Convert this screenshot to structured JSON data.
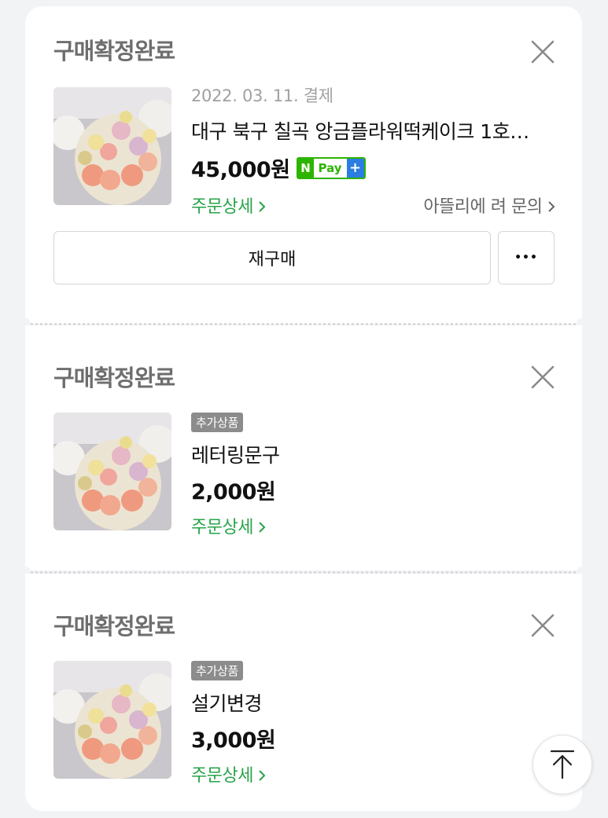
{
  "orders": [
    {
      "status": "구매확정완료",
      "date": "2022. 03. 11. 결제",
      "product": "대구 북구 칠곡 앙금플라워떡케이크 1호…",
      "price": "45,000원",
      "npay": {
        "n": "N",
        "pay": "Pay",
        "plus": "+"
      },
      "detail_link": "주문상세",
      "inquiry_link": "아뜰리에 려 문의",
      "rebuy_label": "재구매",
      "more_label": "•••"
    },
    {
      "status": "구매확정완료",
      "badge": "추가상품",
      "product": "레터링문구",
      "price": "2,000원",
      "detail_link": "주문상세"
    },
    {
      "status": "구매확정완료",
      "badge": "추가상품",
      "product": "설기변경",
      "price": "3,000원",
      "detail_link": "주문상세"
    }
  ],
  "colors": {
    "accent_green": "#27a348",
    "npay_green": "#2db400",
    "npay_blue": "#2a7de1"
  },
  "icons": [
    "close-icon",
    "chevron-right-icon",
    "scroll-top-icon"
  ]
}
